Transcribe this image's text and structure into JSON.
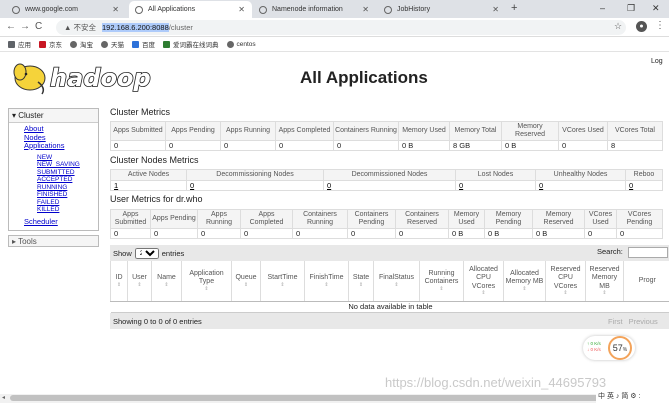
{
  "browser": {
    "tabs": [
      {
        "label": "www.google.com",
        "active": false
      },
      {
        "label": "All Applications",
        "active": true
      },
      {
        "label": "Namenode information",
        "active": false
      },
      {
        "label": "JobHistory",
        "active": false
      }
    ],
    "new_tab_label": "+",
    "window_controls": {
      "minimize": "–",
      "restore": "❐",
      "close": "✕"
    },
    "nav": {
      "back": "←",
      "forward": "→",
      "reload": "C",
      "home": "⌂"
    },
    "address": {
      "security_label": "▲ 不安全",
      "host": "192.168.6.200:8088",
      "path": "/cluster"
    },
    "profile_initial": "●",
    "bookmarks": [
      {
        "label": "应用",
        "color": "#e94235"
      },
      {
        "label": "京东",
        "color": "#c81623"
      },
      {
        "label": "淘宝",
        "color": "#666666"
      },
      {
        "label": "天猫",
        "color": "#666666"
      },
      {
        "label": "百度",
        "color": "#2d72d9"
      },
      {
        "label": "爱词霸在线词典",
        "color": "#2e7d32"
      },
      {
        "label": "centos",
        "color": "#666666"
      }
    ]
  },
  "page": {
    "title": "All Applications",
    "logo_text": "hadoop",
    "logout_text": "Log",
    "sidebar": {
      "header": "Cluster",
      "links": [
        "About",
        "Nodes",
        "Applications"
      ],
      "states": [
        "NEW",
        "NEW_SAVING",
        "SUBMITTED",
        "ACCEPTED",
        "RUNNING",
        "FINISHED",
        "FAILED",
        "KILLED"
      ],
      "scheduler": "Scheduler",
      "tools": "Tools"
    },
    "cluster_metrics": {
      "title": "Cluster Metrics",
      "headers": [
        "Apps Submitted",
        "Apps Pending",
        "Apps Running",
        "Apps Completed",
        "Containers Running",
        "Memory Used",
        "Memory Total",
        "Memory Reserved",
        "VCores Used",
        "VCores Total"
      ],
      "values": [
        "0",
        "0",
        "0",
        "0",
        "0",
        "0 B",
        "8 GB",
        "0 B",
        "0",
        "8"
      ]
    },
    "nodes_metrics": {
      "title": "Cluster Nodes Metrics",
      "headers": [
        "Active Nodes",
        "Decommissioning Nodes",
        "Decommissioned Nodes",
        "Lost Nodes",
        "Unhealthy Nodes",
        "Reboo"
      ],
      "values": [
        "1",
        "0",
        "0",
        "0",
        "0",
        "0"
      ]
    },
    "user_metrics": {
      "title": "User Metrics for dr.who",
      "headers": [
        "Apps Submitted",
        "Apps Pending",
        "Apps Running",
        "Apps Completed",
        "Containers Running",
        "Containers Pending",
        "Containers Reserved",
        "Memory Used",
        "Memory Pending",
        "Memory Reserved",
        "VCores Used",
        "VCores Pending"
      ],
      "values": [
        "0",
        "0",
        "0",
        "0",
        "0",
        "0",
        "0",
        "0 B",
        "0 B",
        "0 B",
        "0",
        "0"
      ]
    },
    "apps_table": {
      "show_label": "Show",
      "entries_value": "20",
      "entries_label": "entries",
      "search_label": "Search:",
      "headers": [
        "ID",
        "User",
        "Name",
        "Application Type",
        "Queue",
        "StartTime",
        "FinishTime",
        "State",
        "FinalStatus",
        "Running Containers",
        "Allocated CPU VCores",
        "Allocated Memory MB",
        "Reserved CPU VCores",
        "Reserved Memory MB",
        "Progr"
      ],
      "empty_message": "No data available in table",
      "info": "Showing 0 to 0 of 0 entries",
      "pager": [
        "First",
        "Previous"
      ]
    },
    "widget": {
      "up_rate": "0 K/s",
      "down_rate": "0 K/s",
      "percent": "57",
      "unit": "%"
    },
    "watermark": "https://blog.csdn.net/weixin_44695793",
    "ime_bar": "中 英 ♪ 简 ⚙ :"
  },
  "colors": {
    "link": "#0000cc",
    "header_bg": "#f4f4f4",
    "toolbar_bg": "#e8e8e8",
    "chrome_tabbar": "#dee1e6"
  }
}
